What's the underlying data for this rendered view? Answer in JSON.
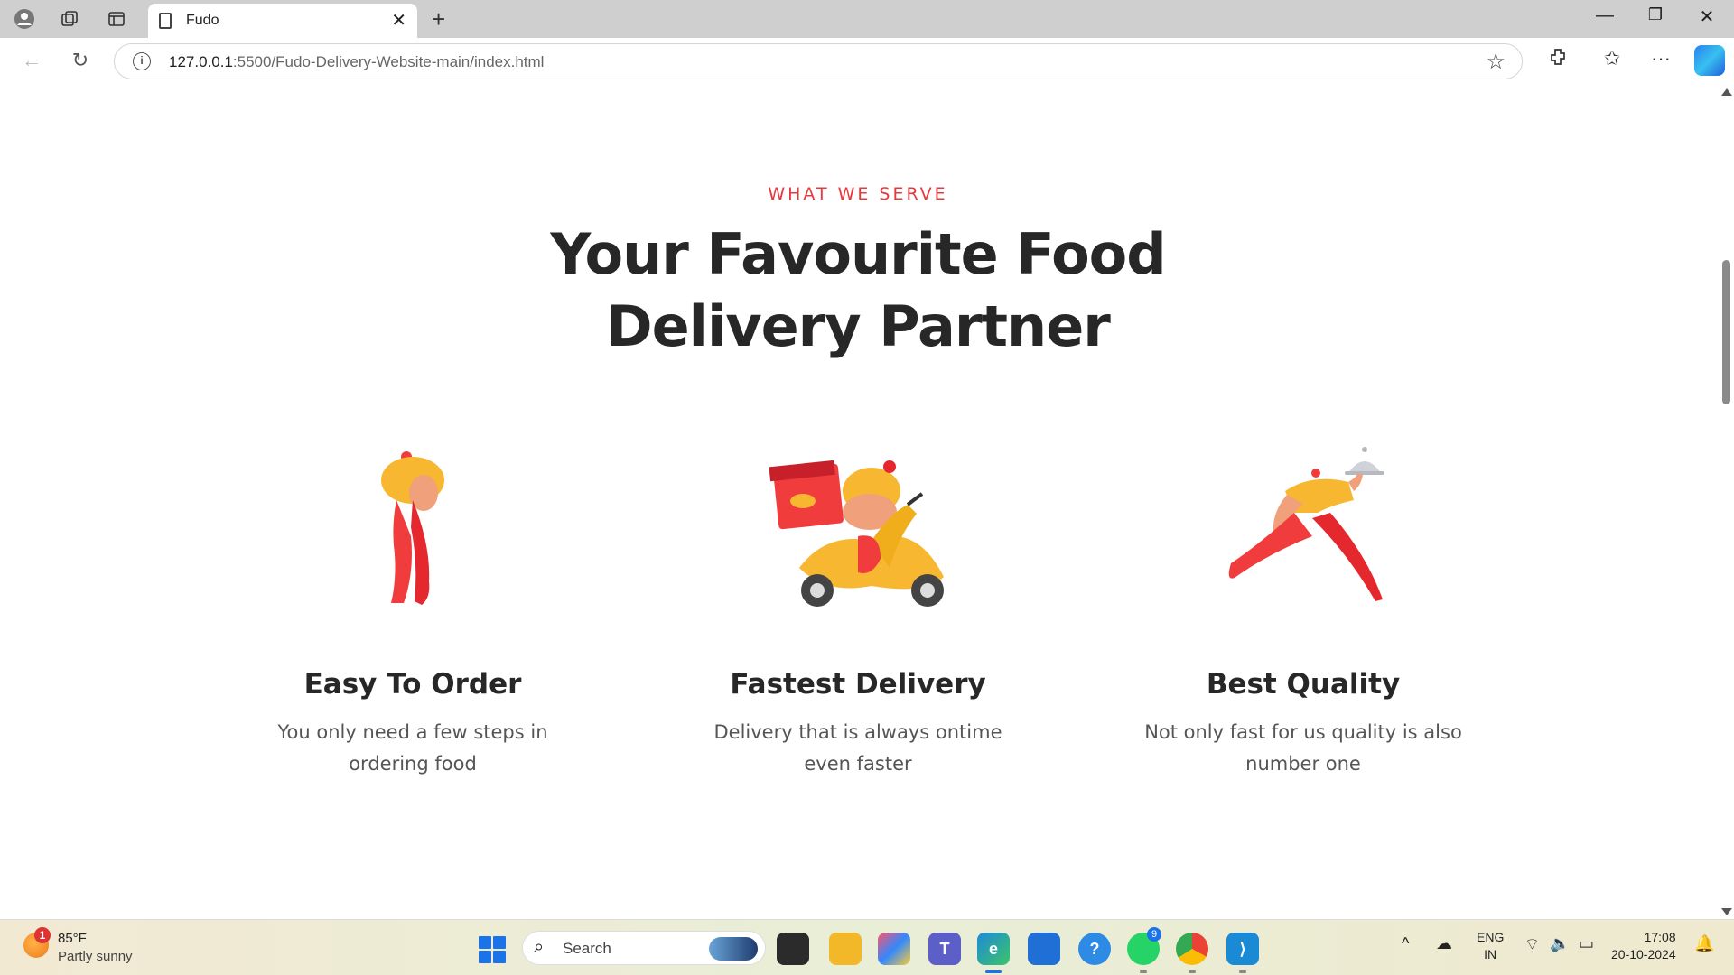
{
  "browser": {
    "tab_title": "Fudo",
    "url_host": "127.0.0.1",
    "url_rest": ":5500/Fudo-Delivery-Website-main/index.html"
  },
  "page": {
    "kicker": "WHAT WE SERVE",
    "heading_line1": "Your Favourite Food",
    "heading_line2": "Delivery Partner",
    "features": [
      {
        "title": "Easy To Order",
        "desc_line1": "You only need a few steps in",
        "desc_line2": "ordering food",
        "icon": "person-standing-icon"
      },
      {
        "title": "Fastest Delivery",
        "desc_line1": "Delivery that is always ontime",
        "desc_line2": "even faster",
        "icon": "scooter-delivery-icon"
      },
      {
        "title": "Best Quality",
        "desc_line1": "Not only fast for us quality is also",
        "desc_line2": "number one",
        "icon": "running-waiter-icon"
      }
    ],
    "colors": {
      "accent": "#e8383d",
      "heading": "#272727",
      "body": "#555555",
      "orange": "#f7b731",
      "red": "#f03c3c"
    }
  },
  "taskbar": {
    "weather_badge": "1",
    "temp": "85°F",
    "weather": "Partly sunny",
    "search_placeholder": "Search",
    "whatsapp_badge": "9",
    "lang_1": "ENG",
    "lang_2": "IN",
    "time": "17:08",
    "date": "20-10-2024"
  }
}
